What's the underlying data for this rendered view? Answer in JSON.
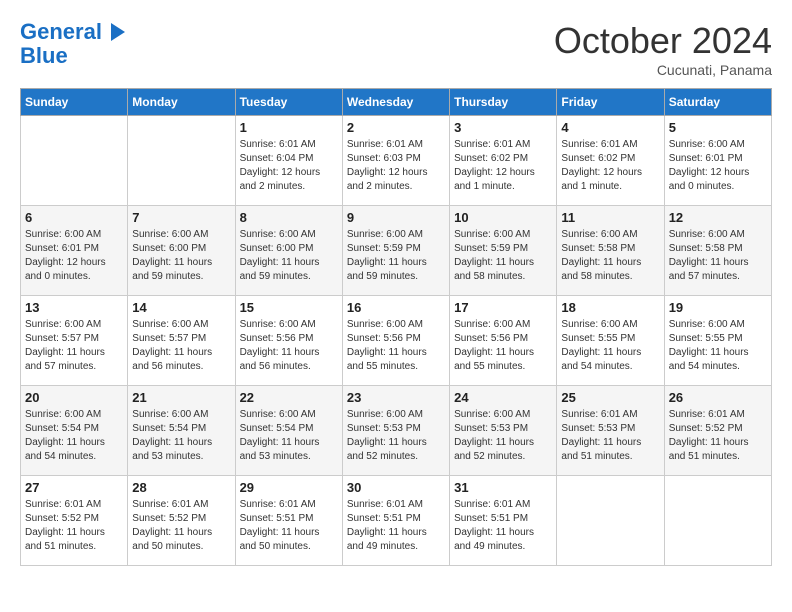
{
  "header": {
    "logo_line1": "General",
    "logo_line2": "Blue",
    "month_title": "October 2024",
    "location": "Cucunati, Panama"
  },
  "weekdays": [
    "Sunday",
    "Monday",
    "Tuesday",
    "Wednesday",
    "Thursday",
    "Friday",
    "Saturday"
  ],
  "weeks": [
    [
      {
        "day": "",
        "info": ""
      },
      {
        "day": "",
        "info": ""
      },
      {
        "day": "1",
        "info": "Sunrise: 6:01 AM\nSunset: 6:04 PM\nDaylight: 12 hours\nand 2 minutes."
      },
      {
        "day": "2",
        "info": "Sunrise: 6:01 AM\nSunset: 6:03 PM\nDaylight: 12 hours\nand 2 minutes."
      },
      {
        "day": "3",
        "info": "Sunrise: 6:01 AM\nSunset: 6:02 PM\nDaylight: 12 hours\nand 1 minute."
      },
      {
        "day": "4",
        "info": "Sunrise: 6:01 AM\nSunset: 6:02 PM\nDaylight: 12 hours\nand 1 minute."
      },
      {
        "day": "5",
        "info": "Sunrise: 6:00 AM\nSunset: 6:01 PM\nDaylight: 12 hours\nand 0 minutes."
      }
    ],
    [
      {
        "day": "6",
        "info": "Sunrise: 6:00 AM\nSunset: 6:01 PM\nDaylight: 12 hours\nand 0 minutes."
      },
      {
        "day": "7",
        "info": "Sunrise: 6:00 AM\nSunset: 6:00 PM\nDaylight: 11 hours\nand 59 minutes."
      },
      {
        "day": "8",
        "info": "Sunrise: 6:00 AM\nSunset: 6:00 PM\nDaylight: 11 hours\nand 59 minutes."
      },
      {
        "day": "9",
        "info": "Sunrise: 6:00 AM\nSunset: 5:59 PM\nDaylight: 11 hours\nand 59 minutes."
      },
      {
        "day": "10",
        "info": "Sunrise: 6:00 AM\nSunset: 5:59 PM\nDaylight: 11 hours\nand 58 minutes."
      },
      {
        "day": "11",
        "info": "Sunrise: 6:00 AM\nSunset: 5:58 PM\nDaylight: 11 hours\nand 58 minutes."
      },
      {
        "day": "12",
        "info": "Sunrise: 6:00 AM\nSunset: 5:58 PM\nDaylight: 11 hours\nand 57 minutes."
      }
    ],
    [
      {
        "day": "13",
        "info": "Sunrise: 6:00 AM\nSunset: 5:57 PM\nDaylight: 11 hours\nand 57 minutes."
      },
      {
        "day": "14",
        "info": "Sunrise: 6:00 AM\nSunset: 5:57 PM\nDaylight: 11 hours\nand 56 minutes."
      },
      {
        "day": "15",
        "info": "Sunrise: 6:00 AM\nSunset: 5:56 PM\nDaylight: 11 hours\nand 56 minutes."
      },
      {
        "day": "16",
        "info": "Sunrise: 6:00 AM\nSunset: 5:56 PM\nDaylight: 11 hours\nand 55 minutes."
      },
      {
        "day": "17",
        "info": "Sunrise: 6:00 AM\nSunset: 5:56 PM\nDaylight: 11 hours\nand 55 minutes."
      },
      {
        "day": "18",
        "info": "Sunrise: 6:00 AM\nSunset: 5:55 PM\nDaylight: 11 hours\nand 54 minutes."
      },
      {
        "day": "19",
        "info": "Sunrise: 6:00 AM\nSunset: 5:55 PM\nDaylight: 11 hours\nand 54 minutes."
      }
    ],
    [
      {
        "day": "20",
        "info": "Sunrise: 6:00 AM\nSunset: 5:54 PM\nDaylight: 11 hours\nand 54 minutes."
      },
      {
        "day": "21",
        "info": "Sunrise: 6:00 AM\nSunset: 5:54 PM\nDaylight: 11 hours\nand 53 minutes."
      },
      {
        "day": "22",
        "info": "Sunrise: 6:00 AM\nSunset: 5:54 PM\nDaylight: 11 hours\nand 53 minutes."
      },
      {
        "day": "23",
        "info": "Sunrise: 6:00 AM\nSunset: 5:53 PM\nDaylight: 11 hours\nand 52 minutes."
      },
      {
        "day": "24",
        "info": "Sunrise: 6:00 AM\nSunset: 5:53 PM\nDaylight: 11 hours\nand 52 minutes."
      },
      {
        "day": "25",
        "info": "Sunrise: 6:01 AM\nSunset: 5:53 PM\nDaylight: 11 hours\nand 51 minutes."
      },
      {
        "day": "26",
        "info": "Sunrise: 6:01 AM\nSunset: 5:52 PM\nDaylight: 11 hours\nand 51 minutes."
      }
    ],
    [
      {
        "day": "27",
        "info": "Sunrise: 6:01 AM\nSunset: 5:52 PM\nDaylight: 11 hours\nand 51 minutes."
      },
      {
        "day": "28",
        "info": "Sunrise: 6:01 AM\nSunset: 5:52 PM\nDaylight: 11 hours\nand 50 minutes."
      },
      {
        "day": "29",
        "info": "Sunrise: 6:01 AM\nSunset: 5:51 PM\nDaylight: 11 hours\nand 50 minutes."
      },
      {
        "day": "30",
        "info": "Sunrise: 6:01 AM\nSunset: 5:51 PM\nDaylight: 11 hours\nand 49 minutes."
      },
      {
        "day": "31",
        "info": "Sunrise: 6:01 AM\nSunset: 5:51 PM\nDaylight: 11 hours\nand 49 minutes."
      },
      {
        "day": "",
        "info": ""
      },
      {
        "day": "",
        "info": ""
      }
    ]
  ]
}
